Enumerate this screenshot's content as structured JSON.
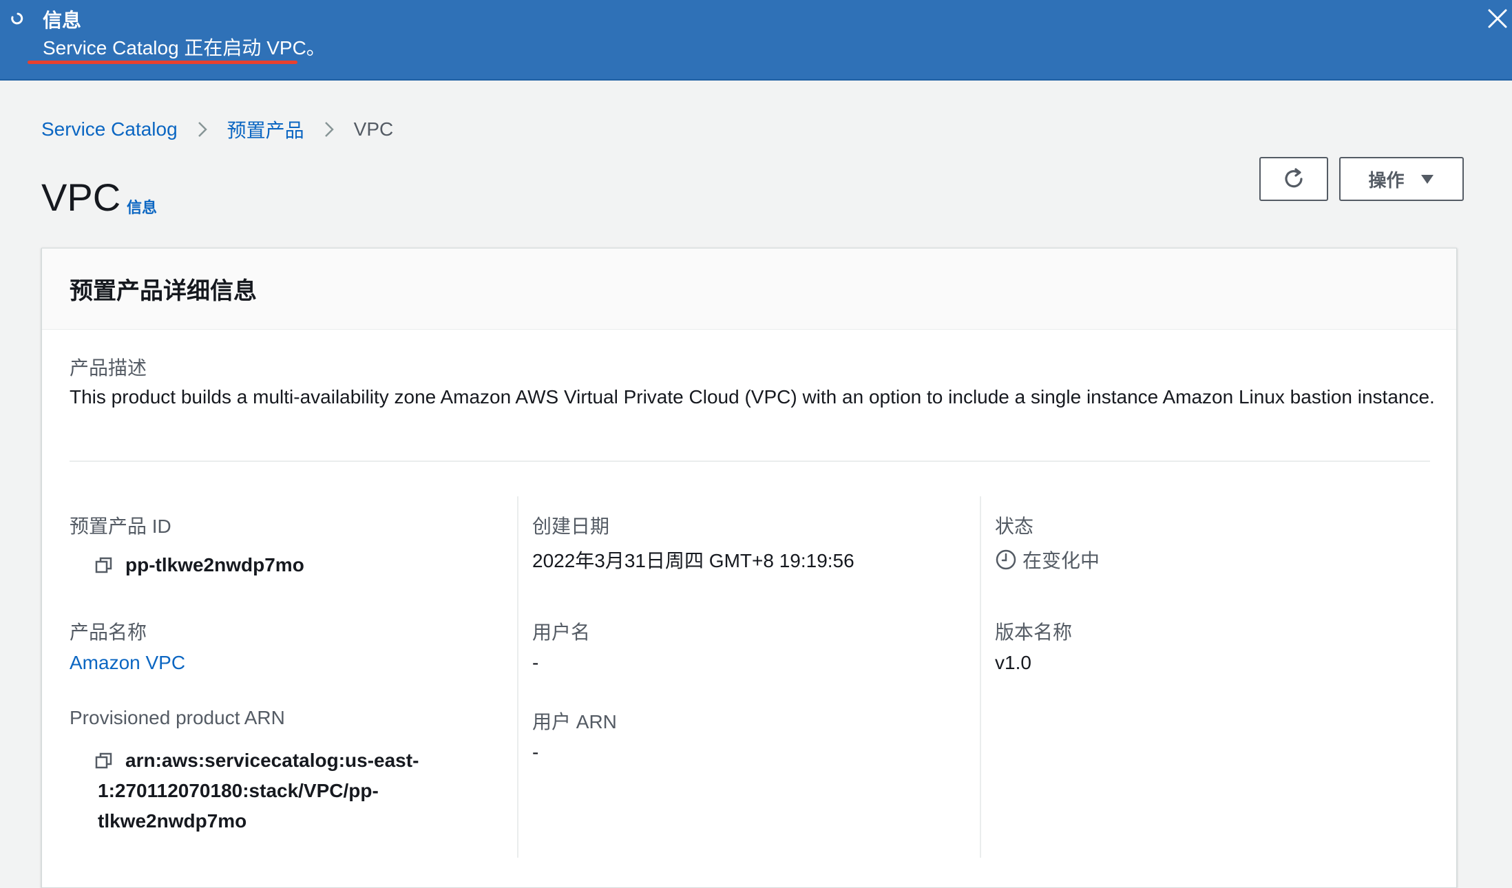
{
  "flash": {
    "title": "信息",
    "message": "Service Catalog 正在启动 VPC。"
  },
  "breadcrumb": {
    "items": [
      "Service Catalog",
      "预置产品",
      "VPC"
    ]
  },
  "page": {
    "title": "VPC",
    "info_link": "信息"
  },
  "toolbar": {
    "actions_label": "操作"
  },
  "panel": {
    "title": "预置产品详细信息",
    "description_label": "产品描述",
    "description": "This product builds a multi-availability zone Amazon AWS Virtual Private Cloud (VPC) with an option to include a single instance Amazon Linux bastion instance.",
    "fields": {
      "provisioned_product_id": {
        "label": "预置产品 ID",
        "value": "pp-tlkwe2nwdp7mo"
      },
      "created_date": {
        "label": "创建日期",
        "value": "2022年3月31日周四 GMT+8 19:19:56"
      },
      "status": {
        "label": "状态",
        "value": "在变化中"
      },
      "product_name": {
        "label": "产品名称",
        "value": "Amazon VPC"
      },
      "user_name": {
        "label": "用户名",
        "value": "-"
      },
      "version_name": {
        "label": "版本名称",
        "value": "v1.0"
      },
      "provisioned_product_arn": {
        "label": "Provisioned product ARN",
        "value_lines": [
          "arn:aws:servicecatalog:us-east-",
          "1:270112070180:stack/VPC/pp-",
          "tlkwe2nwdp7mo"
        ]
      },
      "user_arn": {
        "label": "用户 ARN",
        "value": "-"
      }
    }
  },
  "colors": {
    "flash_bg": "#2f71b7",
    "link": "#0b66c2",
    "underline_annotation": "#e8402e",
    "page_bg": "#f2f3f3"
  }
}
